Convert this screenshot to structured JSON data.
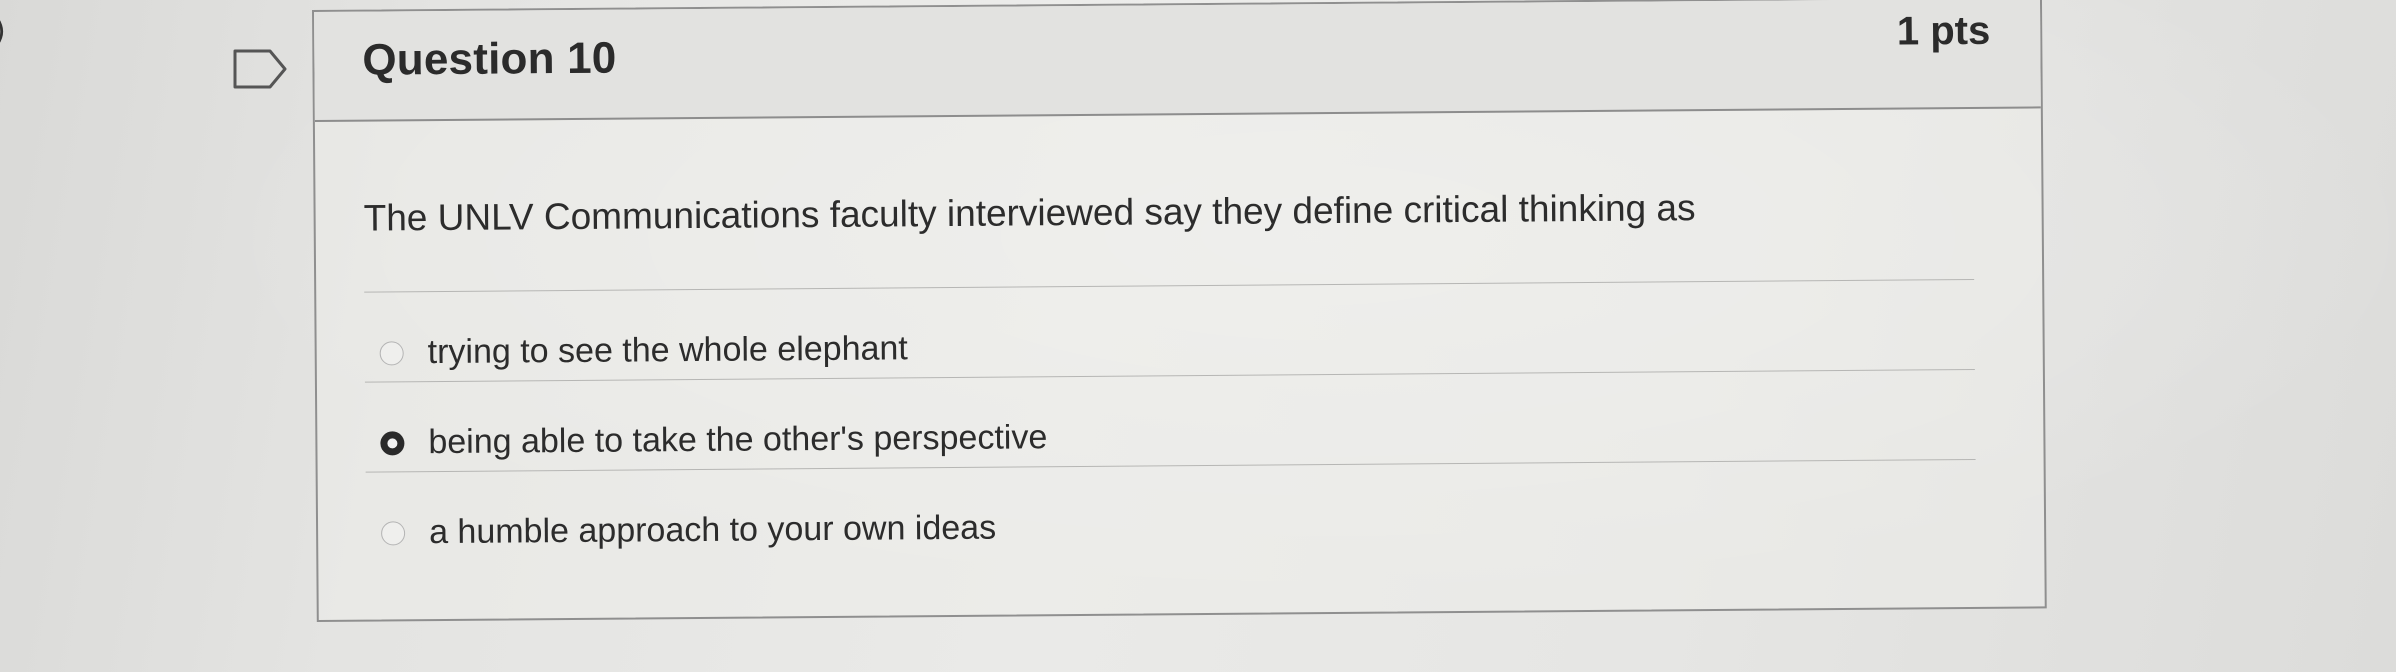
{
  "question": {
    "title": "Question 10",
    "points": "1 pts",
    "prompt": "The UNLV Communications faculty interviewed say they define critical thinking as",
    "flag_icon": "flag-question-icon"
  },
  "answers": [
    {
      "label": "trying to see the whole elephant",
      "selected": false
    },
    {
      "label": "being able to take the other's perspective",
      "selected": true
    },
    {
      "label": "a humble approach to your own ideas",
      "selected": false
    }
  ],
  "edge_text": ")"
}
